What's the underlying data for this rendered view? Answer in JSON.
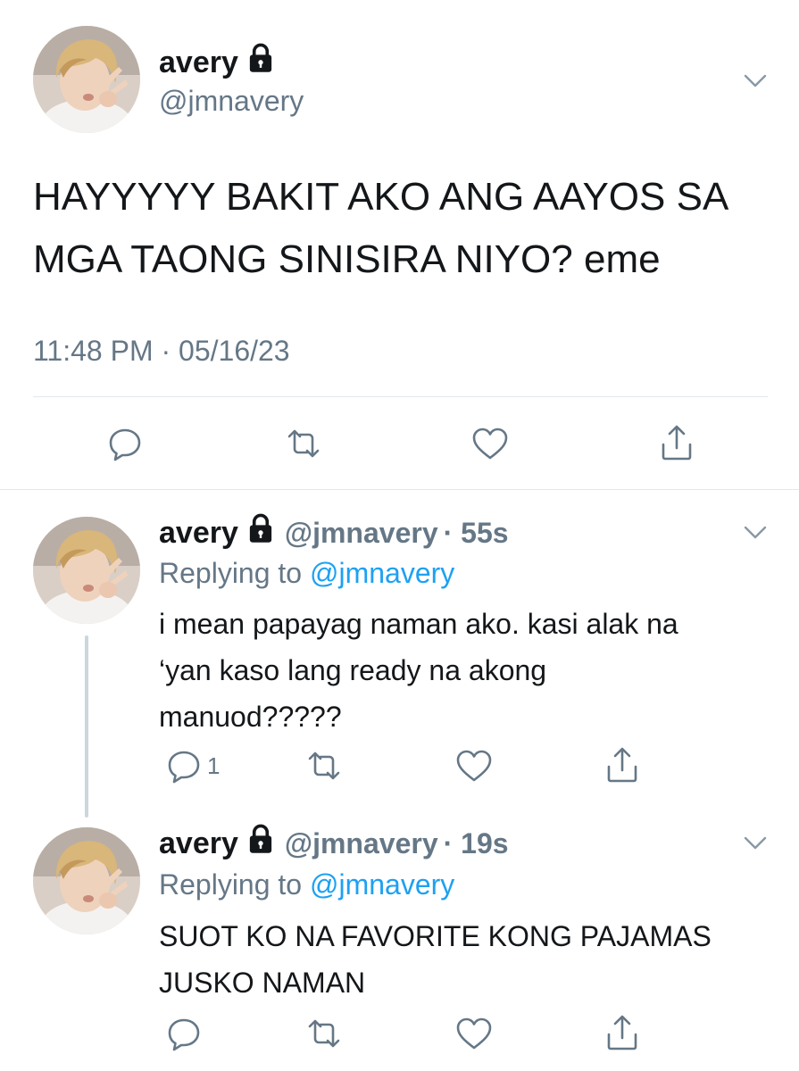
{
  "main_tweet": {
    "author_name": "avery",
    "handle": "@jmnavery",
    "text_line1": "HAYYYYY BAKIT AKO ANG AAYOS SA",
    "text_line2": "MGA TAONG SINISIRA NIYO? eme",
    "timestamp": "11:48 PM · 05/16/23"
  },
  "replies": [
    {
      "author_name": "avery",
      "handle": "@jmnavery",
      "time": "· 55s",
      "replying_label": "Replying to ",
      "replying_to": "@jmnavery",
      "text_line1": "i mean papayag naman ako. kasi alak na",
      "text_line2": "‘yan kaso lang ready na akong",
      "text_line3": "manuod?????",
      "reply_count": "1"
    },
    {
      "author_name": "avery",
      "handle": "@jmnavery",
      "time": "· 19s",
      "replying_label": "Replying to ",
      "replying_to": "@jmnavery",
      "text_line1": "SUOT KO NA FAVORITE KONG PAJAMAS",
      "text_line2": "JUSKO NAMAN"
    }
  ],
  "icons": {
    "lock": "lock-icon",
    "chevron": "chevron-down-icon",
    "reply": "reply-icon",
    "retweet": "retweet-icon",
    "like": "heart-icon",
    "share": "share-icon"
  },
  "colors": {
    "text": "#14171a",
    "secondary": "#657786",
    "link": "#1da1f2",
    "divider": "#e1e8ed"
  }
}
